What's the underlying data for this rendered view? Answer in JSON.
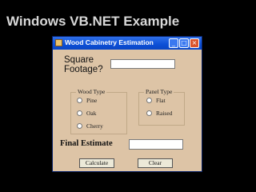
{
  "slide": {
    "title": "Windows VB.NET Example"
  },
  "window": {
    "title": "Wood Cabinetry Estimation",
    "controls": {
      "minimize": "_",
      "maximize": "□",
      "close": "×"
    }
  },
  "square_footage": {
    "label_line1": "Square",
    "label_line2": "Footage?",
    "value": ""
  },
  "wood_type": {
    "legend": "Wood Type",
    "options": [
      {
        "label": "Pine"
      },
      {
        "label": "Oak"
      },
      {
        "label": "Cherry"
      }
    ]
  },
  "panel_type": {
    "legend": "Panel Type",
    "options": [
      {
        "label": "Flat"
      },
      {
        "label": "Raised"
      }
    ]
  },
  "final_estimate": {
    "label": "Final Estimate",
    "value": ""
  },
  "buttons": {
    "calculate": "Calculate",
    "clear": "Clear"
  }
}
